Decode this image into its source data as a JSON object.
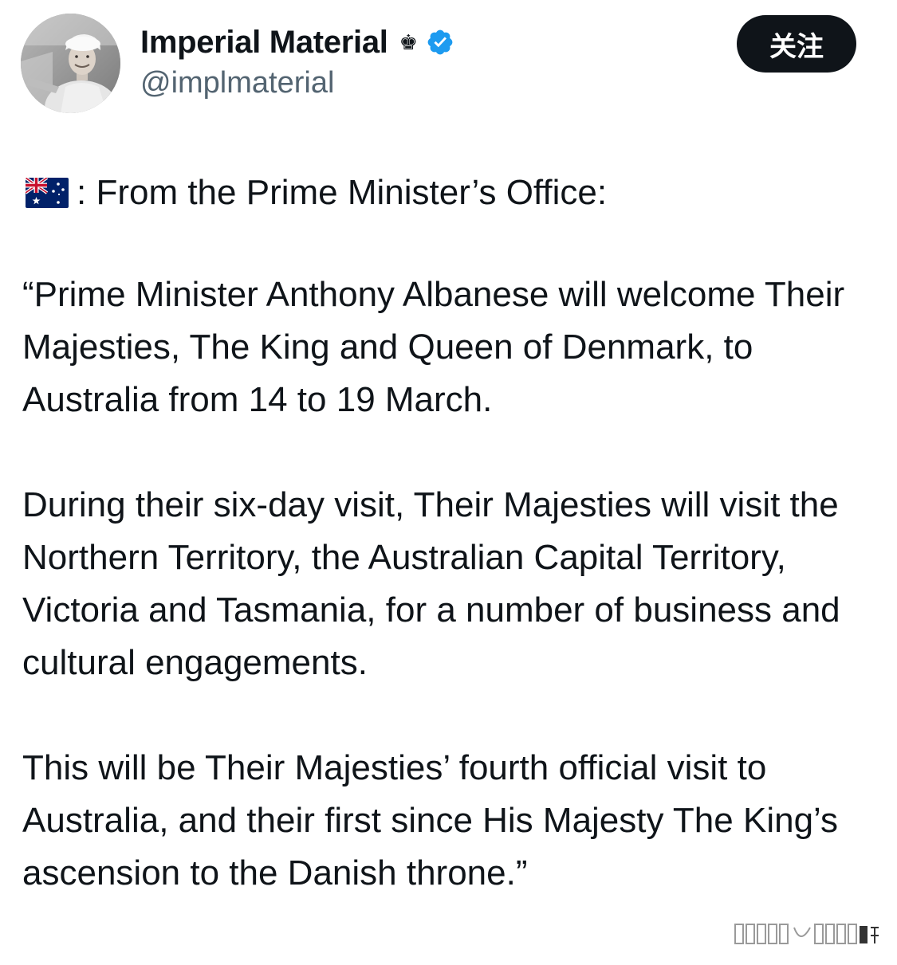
{
  "header": {
    "display_name": "Imperial Material",
    "handle": "@implmaterial",
    "name_emoji": "♚",
    "verified_color": "#1d9bf0",
    "follow_label": "关注"
  },
  "tweet": {
    "flag_icon": "australia-flag",
    "office_line": ": From the Prime Minister’s Office:",
    "paragraph_1": "“Prime Minister Anthony Albanese will welcome Their Majesties, The King and Queen of Denmark, to Australia from 14 to 19 March.",
    "paragraph_2": "During their six-day visit, Their Majesties will visit the Northern Territory, the Australian Capital Territory, Victoria and Tasmania, for a number of business and cultural engagements.",
    "paragraph_3": "This will be Their Majesties’ fourth official visit to Australia, and their first since His Majesty The King’s ascension to the Danish throne.”"
  },
  "colors": {
    "text_primary": "#0f1419",
    "text_secondary": "#536471",
    "button_bg": "#0f1419",
    "button_text": "#ffffff"
  }
}
